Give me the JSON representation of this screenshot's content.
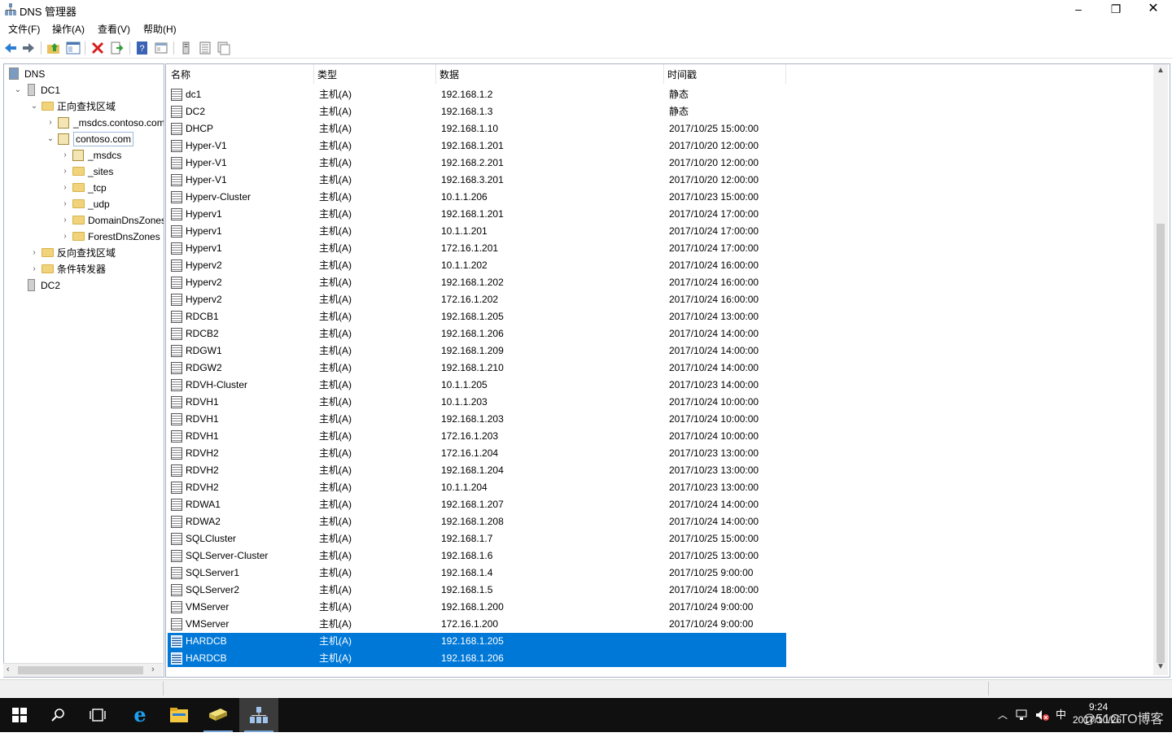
{
  "window": {
    "title": "DNS 管理器",
    "minimize": "–",
    "maximize": "❐",
    "close": "✕"
  },
  "menu": [
    "文件(F)",
    "操作(A)",
    "查看(V)",
    "帮助(H)"
  ],
  "toolbar_icons": [
    "back-arrow-icon",
    "forward-arrow-icon",
    "up-folder-icon",
    "show-hide-tree-icon",
    "delete-icon",
    "export-list-icon",
    "help-icon",
    "properties-icon",
    "server-icon",
    "list-icon",
    "zone-icon"
  ],
  "tree": [
    {
      "label": "DNS",
      "level": 0,
      "icon": "dns-icon",
      "arrow": ""
    },
    {
      "label": "DC1",
      "level": 1,
      "icon": "server-icon",
      "arrow": "⌄"
    },
    {
      "label": "正向查找区域",
      "level": 2,
      "icon": "folder-icon",
      "arrow": "⌄"
    },
    {
      "label": "_msdcs.contoso.com",
      "level": 3,
      "icon": "zone-icon",
      "arrow": "›"
    },
    {
      "label": "contoso.com",
      "level": 3,
      "icon": "zone-icon",
      "arrow": "⌄",
      "selected": true
    },
    {
      "label": "_msdcs",
      "level": 4,
      "icon": "zone-icon",
      "arrow": "›"
    },
    {
      "label": "_sites",
      "level": 4,
      "icon": "folder-icon",
      "arrow": "›"
    },
    {
      "label": "_tcp",
      "level": 4,
      "icon": "folder-icon",
      "arrow": "›"
    },
    {
      "label": "_udp",
      "level": 4,
      "icon": "folder-icon",
      "arrow": "›"
    },
    {
      "label": "DomainDnsZones",
      "level": 4,
      "icon": "folder-icon",
      "arrow": "›"
    },
    {
      "label": "ForestDnsZones",
      "level": 4,
      "icon": "folder-icon",
      "arrow": "›"
    },
    {
      "label": "反向查找区域",
      "level": 2,
      "icon": "folder-icon",
      "arrow": "›"
    },
    {
      "label": "条件转发器",
      "level": 2,
      "icon": "folder-icon",
      "arrow": "›"
    },
    {
      "label": "DC2",
      "level": 1,
      "icon": "server-icon",
      "arrow": ""
    }
  ],
  "columns": [
    "名称",
    "类型",
    "数据",
    "时间戳"
  ],
  "records": [
    {
      "name": "dc1",
      "type": "主机(A)",
      "data": "192.168.1.2",
      "ts": "静态"
    },
    {
      "name": "DC2",
      "type": "主机(A)",
      "data": "192.168.1.3",
      "ts": "静态"
    },
    {
      "name": "DHCP",
      "type": "主机(A)",
      "data": "192.168.1.10",
      "ts": "2017/10/25 15:00:00"
    },
    {
      "name": "Hyper-V1",
      "type": "主机(A)",
      "data": "192.168.1.201",
      "ts": "2017/10/20 12:00:00"
    },
    {
      "name": "Hyper-V1",
      "type": "主机(A)",
      "data": "192.168.2.201",
      "ts": "2017/10/20 12:00:00"
    },
    {
      "name": "Hyper-V1",
      "type": "主机(A)",
      "data": "192.168.3.201",
      "ts": "2017/10/20 12:00:00"
    },
    {
      "name": "Hyperv-Cluster",
      "type": "主机(A)",
      "data": "10.1.1.206",
      "ts": "2017/10/23 15:00:00"
    },
    {
      "name": "Hyperv1",
      "type": "主机(A)",
      "data": "192.168.1.201",
      "ts": "2017/10/24 17:00:00"
    },
    {
      "name": "Hyperv1",
      "type": "主机(A)",
      "data": "10.1.1.201",
      "ts": "2017/10/24 17:00:00"
    },
    {
      "name": "Hyperv1",
      "type": "主机(A)",
      "data": "172.16.1.201",
      "ts": "2017/10/24 17:00:00"
    },
    {
      "name": "Hyperv2",
      "type": "主机(A)",
      "data": "10.1.1.202",
      "ts": "2017/10/24 16:00:00"
    },
    {
      "name": "Hyperv2",
      "type": "主机(A)",
      "data": "192.168.1.202",
      "ts": "2017/10/24 16:00:00"
    },
    {
      "name": "Hyperv2",
      "type": "主机(A)",
      "data": "172.16.1.202",
      "ts": "2017/10/24 16:00:00"
    },
    {
      "name": "RDCB1",
      "type": "主机(A)",
      "data": "192.168.1.205",
      "ts": "2017/10/24 13:00:00"
    },
    {
      "name": "RDCB2",
      "type": "主机(A)",
      "data": "192.168.1.206",
      "ts": "2017/10/24 14:00:00"
    },
    {
      "name": "RDGW1",
      "type": "主机(A)",
      "data": "192.168.1.209",
      "ts": "2017/10/24 14:00:00"
    },
    {
      "name": "RDGW2",
      "type": "主机(A)",
      "data": "192.168.1.210",
      "ts": "2017/10/24 14:00:00"
    },
    {
      "name": "RDVH-Cluster",
      "type": "主机(A)",
      "data": "10.1.1.205",
      "ts": "2017/10/23 14:00:00"
    },
    {
      "name": "RDVH1",
      "type": "主机(A)",
      "data": "10.1.1.203",
      "ts": "2017/10/24 10:00:00"
    },
    {
      "name": "RDVH1",
      "type": "主机(A)",
      "data": "192.168.1.203",
      "ts": "2017/10/24 10:00:00"
    },
    {
      "name": "RDVH1",
      "type": "主机(A)",
      "data": "172.16.1.203",
      "ts": "2017/10/24 10:00:00"
    },
    {
      "name": "RDVH2",
      "type": "主机(A)",
      "data": "172.16.1.204",
      "ts": "2017/10/23 13:00:00"
    },
    {
      "name": "RDVH2",
      "type": "主机(A)",
      "data": "192.168.1.204",
      "ts": "2017/10/23 13:00:00"
    },
    {
      "name": "RDVH2",
      "type": "主机(A)",
      "data": "10.1.1.204",
      "ts": "2017/10/23 13:00:00"
    },
    {
      "name": "RDWA1",
      "type": "主机(A)",
      "data": "192.168.1.207",
      "ts": "2017/10/24 14:00:00"
    },
    {
      "name": "RDWA2",
      "type": "主机(A)",
      "data": "192.168.1.208",
      "ts": "2017/10/24 14:00:00"
    },
    {
      "name": "SQLCluster",
      "type": "主机(A)",
      "data": "192.168.1.7",
      "ts": "2017/10/25 15:00:00"
    },
    {
      "name": "SQLServer-Cluster",
      "type": "主机(A)",
      "data": "192.168.1.6",
      "ts": "2017/10/25 13:00:00"
    },
    {
      "name": "SQLServer1",
      "type": "主机(A)",
      "data": "192.168.1.4",
      "ts": "2017/10/25 9:00:00"
    },
    {
      "name": "SQLServer2",
      "type": "主机(A)",
      "data": "192.168.1.5",
      "ts": "2017/10/24 18:00:00"
    },
    {
      "name": "VMServer",
      "type": "主机(A)",
      "data": "192.168.1.200",
      "ts": "2017/10/24 9:00:00"
    },
    {
      "name": "VMServer",
      "type": "主机(A)",
      "data": "172.16.1.200",
      "ts": "2017/10/24 9:00:00"
    },
    {
      "name": "HARDCB",
      "type": "主机(A)",
      "data": "192.168.1.205",
      "ts": "",
      "selected": true
    },
    {
      "name": "HARDCB",
      "type": "主机(A)",
      "data": "192.168.1.206",
      "ts": "",
      "selected": true
    }
  ],
  "taskbar": {
    "apps": [
      "start-icon",
      "search-icon",
      "task-view-icon",
      "ie-icon",
      "file-explorer-icon",
      "server-manager-icon",
      "dns-manager-icon"
    ],
    "ime": "中",
    "time": "9:24",
    "date": "2017/10/26",
    "watermark": "@51CTO博客"
  },
  "colors": {
    "selection": "#0078d7",
    "taskbar": "#101010"
  }
}
